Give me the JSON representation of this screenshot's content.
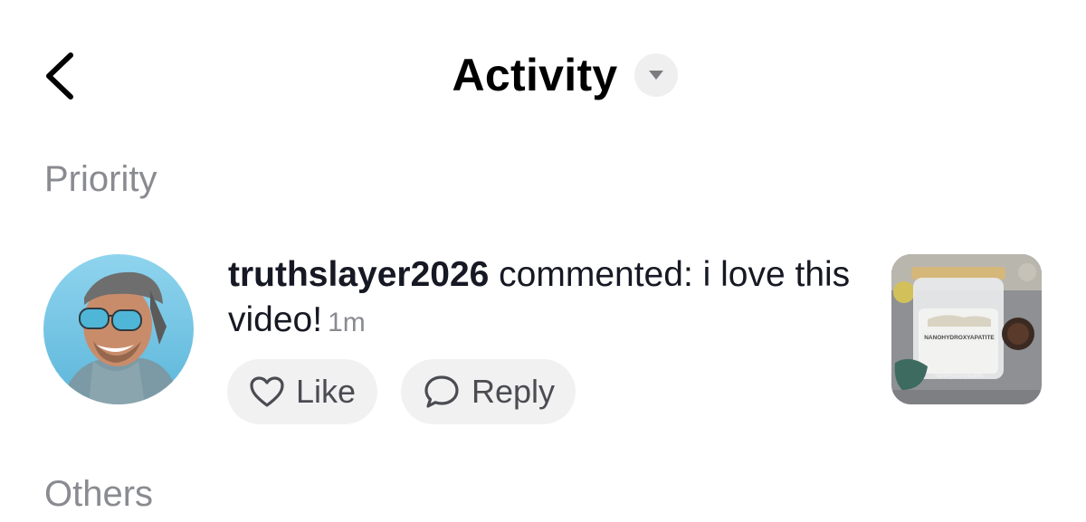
{
  "header": {
    "title": "Activity",
    "back_icon": "chevron-left-icon",
    "dropdown_icon": "caret-down-icon"
  },
  "sections": {
    "priority_label": "Priority",
    "others_label": "Others"
  },
  "notification": {
    "username": "truthslayer2026",
    "action_text": " commented: i love this video!",
    "time": "1m",
    "like_label": "Like",
    "reply_label": "Reply",
    "thumbnail_text_top": "NANOHYDROXYAPATITE",
    "thumbnail_text_bottom": "nanohydroxyapatite"
  },
  "colors": {
    "text_primary": "#161823",
    "text_secondary": "#8a8b91",
    "pill_bg": "#f1f1f2"
  }
}
